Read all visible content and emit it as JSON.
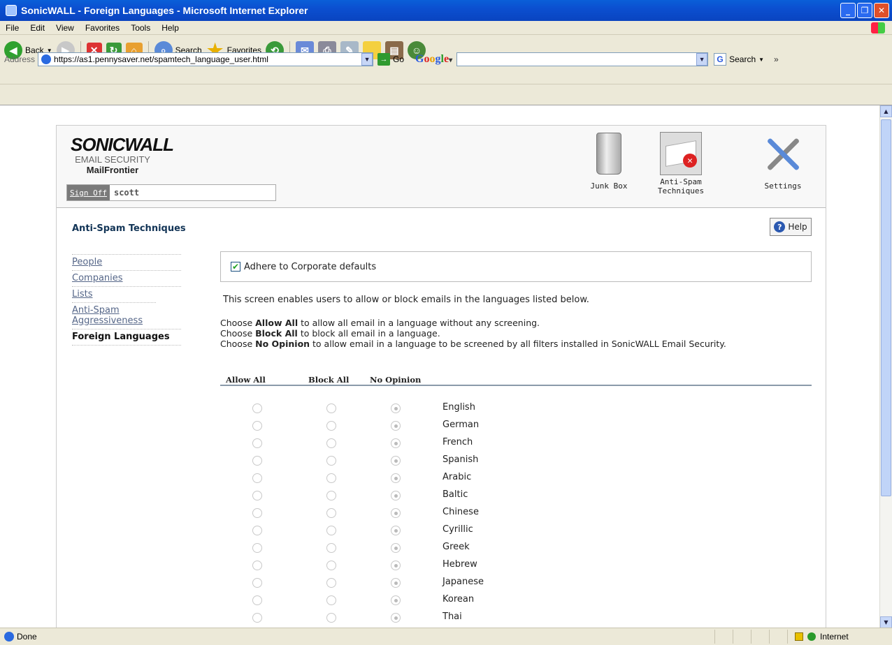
{
  "window": {
    "title": "SonicWALL - Foreign Languages - Microsoft Internet Explorer"
  },
  "menu": [
    "File",
    "Edit",
    "View",
    "Favorites",
    "Tools",
    "Help"
  ],
  "toolbar": {
    "back": "Back",
    "search": "Search",
    "favorites": "Favorites"
  },
  "address": {
    "label": "Address",
    "url": "https://as1.pennysaver.net/spamtech_language_user.html",
    "go": "Go"
  },
  "google": {
    "logo": "Google",
    "search": "Search"
  },
  "header": {
    "brand": "SONICWALL",
    "sub1": "EMAIL SECURITY",
    "sub2": "MailFrontier",
    "signoff": "Sign Off",
    "user": "scott",
    "nav": [
      {
        "label": "Junk Box",
        "icon": "trash-can-icon"
      },
      {
        "label": "Anti-Spam Techniques",
        "icon": "envelope-block-icon"
      },
      {
        "label": "Settings",
        "icon": "tools-icon"
      }
    ]
  },
  "page": {
    "section_title": "Anti-Spam Techniques",
    "help": "Help",
    "sidenav": [
      "People",
      "Companies",
      "Lists",
      "Anti-Spam Aggressiveness",
      "Foreign Languages"
    ],
    "corporate_defaults": "Adhere to Corporate defaults",
    "description": "This screen enables users to allow or block emails in the languages listed below.",
    "choose": [
      {
        "pre": "Choose ",
        "bold": "Allow All",
        "post": " to allow all email in a language without any screening."
      },
      {
        "pre": "Choose ",
        "bold": "Block All",
        "post": " to block all email in a language."
      },
      {
        "pre": "Choose ",
        "bold": "No Opinion",
        "post": " to allow email in a language to be screened by all filters installed in SonicWALL Email Security."
      }
    ],
    "columns": [
      "Allow All",
      "Block All",
      "No Opinion"
    ],
    "languages": [
      "English",
      "German",
      "French",
      "Spanish",
      "Arabic",
      "Baltic",
      "Chinese",
      "Cyrillic",
      "Greek",
      "Hebrew",
      "Japanese",
      "Korean",
      "Thai"
    ],
    "selected_column": "No Opinion"
  },
  "status": {
    "text": "Done",
    "zone": "Internet"
  }
}
